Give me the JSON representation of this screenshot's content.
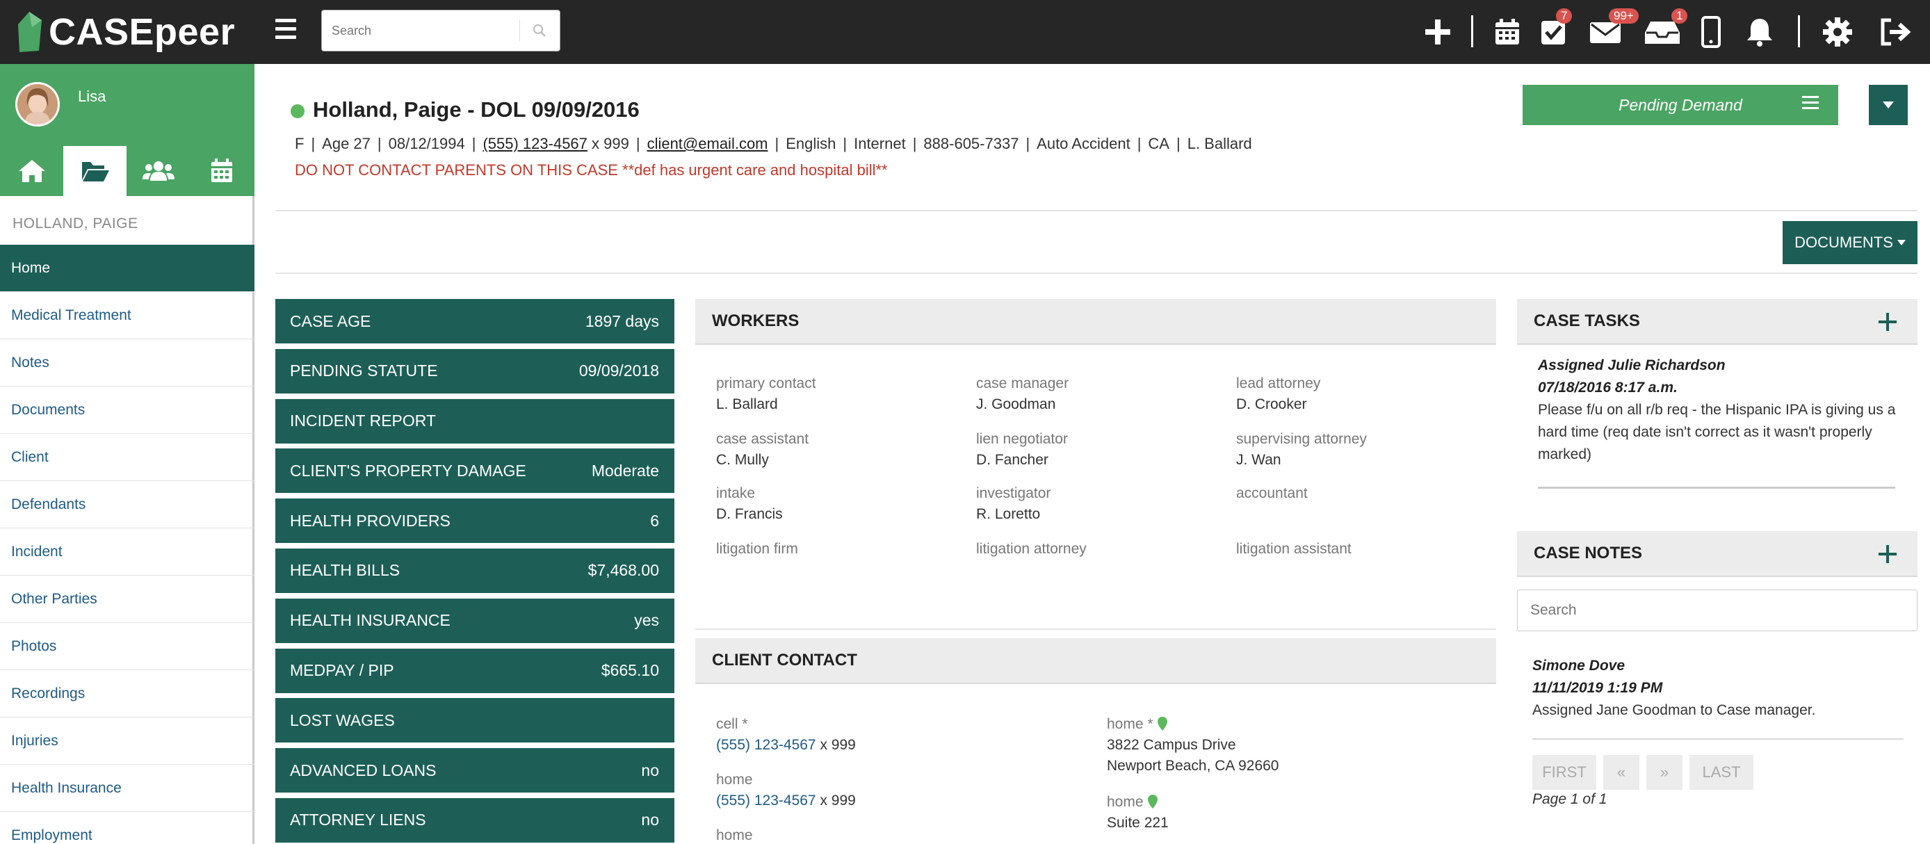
{
  "app": {
    "logo_text": "CASEpeer"
  },
  "topbar": {
    "search_placeholder": "Search",
    "badges": {
      "tasks": "7",
      "mail": "99+",
      "inbox": "1"
    },
    "icons": [
      "plus-icon",
      "calendar-icon",
      "task-check-icon",
      "mail-icon",
      "inbox-icon",
      "phone-icon",
      "bell-icon",
      "gear-icon",
      "logout-icon"
    ]
  },
  "sidebar": {
    "username": "Lisa",
    "case_name": "HOLLAND, PAIGE",
    "tabs": [
      "home-icon",
      "folder-icon",
      "users-icon",
      "calendar-icon"
    ],
    "items": [
      {
        "label": "Home"
      },
      {
        "label": "Medical Treatment"
      },
      {
        "label": "Notes"
      },
      {
        "label": "Documents"
      },
      {
        "label": "Client"
      },
      {
        "label": "Defendants"
      },
      {
        "label": "Incident"
      },
      {
        "label": "Other Parties"
      },
      {
        "label": "Photos"
      },
      {
        "label": "Recordings"
      },
      {
        "label": "Injuries"
      },
      {
        "label": "Health Insurance"
      },
      {
        "label": "Employment"
      }
    ]
  },
  "case": {
    "title": "Holland, Paige - DOL 09/09/2016",
    "gender": "F",
    "age": "Age 27",
    "dob": "08/12/1994",
    "phone": "(555) 123-4567",
    "ext": " x 999",
    "email": "client@email.com",
    "language": "English",
    "source": "Internet",
    "phone2": "888-605-7337",
    "case_type": "Auto Accident",
    "state": "CA",
    "attorney": "L. Ballard",
    "warning": "DO NOT CONTACT PARENTS ON THIS CASE **def has urgent care and hospital bill**",
    "status_label": "Pending Demand",
    "documents_label": "DOCUMENTS"
  },
  "stats": [
    {
      "label": "CASE AGE",
      "value": "1897 days"
    },
    {
      "label": "PENDING STATUTE",
      "value": "09/09/2018"
    },
    {
      "label": "INCIDENT REPORT",
      "value": ""
    },
    {
      "label": "CLIENT'S PROPERTY DAMAGE",
      "value": "Moderate"
    },
    {
      "label": "HEALTH PROVIDERS",
      "value": "6"
    },
    {
      "label": "HEALTH BILLS",
      "value": "$7,468.00"
    },
    {
      "label": "HEALTH INSURANCE",
      "value": "yes"
    },
    {
      "label": "MEDPAY / PIP",
      "value": "$665.10"
    },
    {
      "label": "LOST WAGES",
      "value": ""
    },
    {
      "label": "ADVANCED LOANS",
      "value": "no"
    },
    {
      "label": "ATTORNEY LIENS",
      "value": "no"
    }
  ],
  "workers": {
    "heading": "WORKERS",
    "items": [
      {
        "label": "primary contact",
        "value": "L. Ballard"
      },
      {
        "label": "case manager",
        "value": "J. Goodman"
      },
      {
        "label": "lead attorney",
        "value": "D. Crooker"
      },
      {
        "label": "case assistant",
        "value": "C. Mully"
      },
      {
        "label": "lien negotiator",
        "value": "D. Fancher"
      },
      {
        "label": "supervising attorney",
        "value": "J. Wan"
      },
      {
        "label": "intake",
        "value": "D. Francis"
      },
      {
        "label": "investigator",
        "value": "R. Loretto"
      },
      {
        "label": "accountant",
        "value": ""
      },
      {
        "label": "litigation firm",
        "value": ""
      },
      {
        "label": "litigation attorney",
        "value": ""
      },
      {
        "label": "litigation assistant",
        "value": ""
      }
    ]
  },
  "client_contact": {
    "heading": "CLIENT CONTACT",
    "cell_label": "cell *",
    "cell_phone": "(555) 123-4567",
    "cell_ext": " x 999",
    "home_label": "home",
    "home_phone": "(555) 123-4567",
    "home_ext": " x 999",
    "home3_label": "home",
    "addr1_label": "home *",
    "addr1_line1": "3822 Campus Drive",
    "addr1_line2": "Newport Beach, CA 92660",
    "addr2_label": "home",
    "addr2_line1": "Suite 221"
  },
  "tasks": {
    "heading": "CASE TASKS",
    "assigned": "Assigned Julie Richardson",
    "date": "07/18/2016 8:17 a.m.",
    "text": "Please f/u on all r/b req - the Hispanic IPA is giving us a hard time (req date isn't correct as it wasn't properly marked)"
  },
  "notes": {
    "heading": "CASE NOTES",
    "search_placeholder": "Search",
    "author": "Simone Dove",
    "date": "11/11/2019 1:19 PM",
    "text": "Assigned Jane Goodman to Case manager.",
    "pager": {
      "first": "FIRST",
      "prev": "«",
      "next": "»",
      "last": "LAST"
    },
    "page_info": "Page 1 of 1"
  },
  "colors": {
    "brand_green": "#4aa463",
    "dark_teal": "#1d5f56",
    "topbar": "#262626",
    "warning_red": "#c0392b",
    "link_blue": "#1e5b86"
  }
}
